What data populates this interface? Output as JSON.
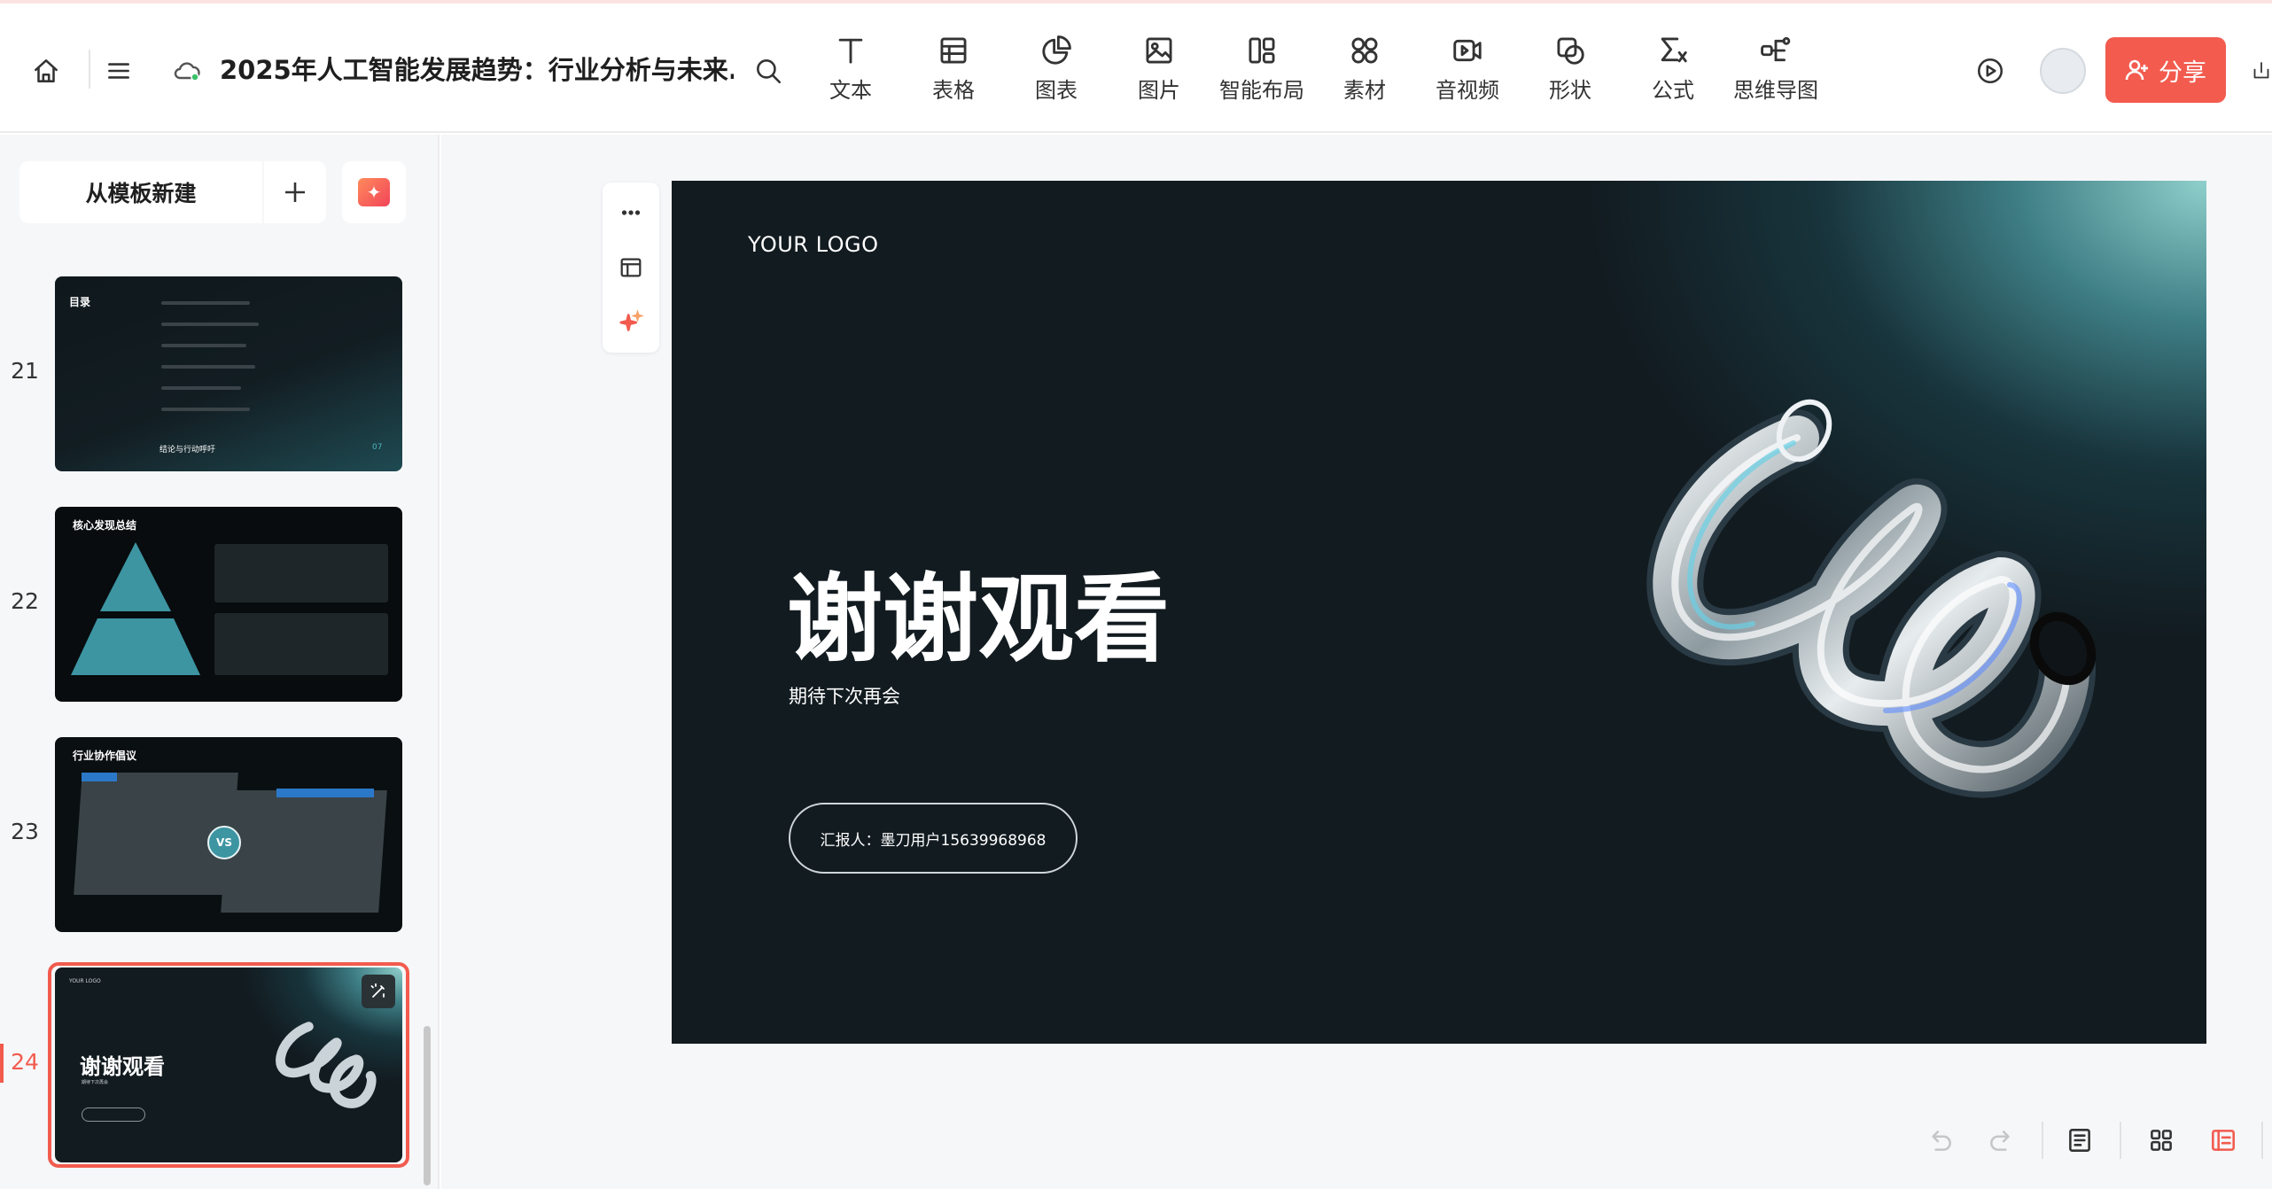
{
  "header": {
    "doc_title": "2025年人工智能发展趋势：行业分析与未来...",
    "tools": [
      {
        "label": "文本",
        "icon": "text-icon"
      },
      {
        "label": "表格",
        "icon": "table-icon"
      },
      {
        "label": "图表",
        "icon": "chart-icon"
      },
      {
        "label": "图片",
        "icon": "image-icon"
      },
      {
        "label": "智能布局",
        "icon": "smart-layout-icon"
      },
      {
        "label": "素材",
        "icon": "assets-icon"
      },
      {
        "label": "音视频",
        "icon": "media-icon"
      },
      {
        "label": "形状",
        "icon": "shape-icon"
      },
      {
        "label": "公式",
        "icon": "formula-icon"
      },
      {
        "label": "思维导图",
        "icon": "mindmap-icon"
      }
    ],
    "share_label": "分享"
  },
  "sidebar": {
    "new_from_template": "从模板新建",
    "slides": [
      {
        "number": "21",
        "title": "目录",
        "footer": "结论与行动呼吁",
        "page": "07"
      },
      {
        "number": "22",
        "title": "核心发现总结"
      },
      {
        "number": "23",
        "title": "行业协作倡议",
        "badge": "VS"
      },
      {
        "number": "24",
        "logo": "YOUR LOGO",
        "title": "谢谢观看",
        "sub": "期待下次再会",
        "active": true
      }
    ]
  },
  "slide": {
    "logo": "YOUR LOGO",
    "title": "谢谢观看",
    "subtitle": "期待下次再会",
    "reporter": "汇报人：墨刀用户15639968968"
  },
  "colors": {
    "accent": "#f25b4e",
    "slide_bg": "#121b20",
    "teal": "#3f8f9a"
  }
}
